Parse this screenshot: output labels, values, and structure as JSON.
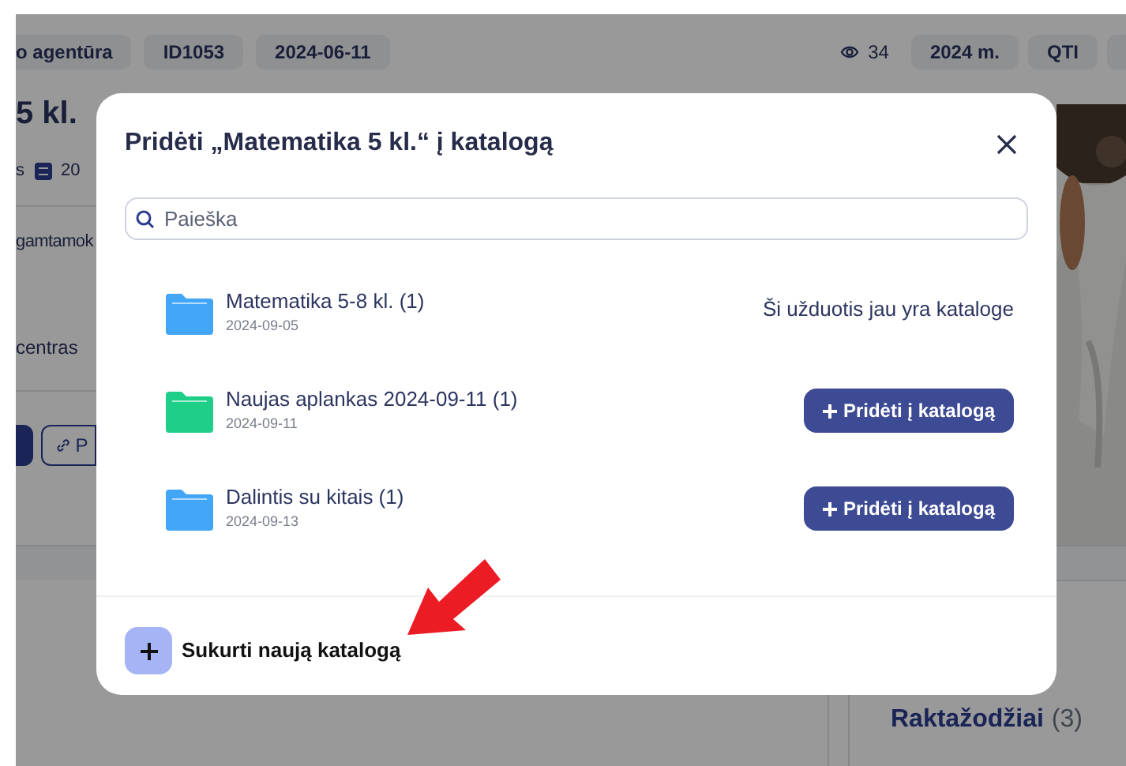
{
  "background_page": {
    "top_chips": [
      "o agentūra",
      "ID1053",
      "2024-06-11"
    ],
    "views": "34",
    "right_chips": [
      "2024 m.",
      "QTI"
    ],
    "title": "5 kl.",
    "meta": [
      "s",
      "20"
    ],
    "lines": [
      "gamtamok",
      "centras"
    ],
    "link_button": "P",
    "keywords_heading": "Raktažodžiai",
    "keywords_count": "(3)",
    "photo": {
      "kind": "picture"
    }
  },
  "dialog": {
    "title": "Pridėti „Matematika 5 kl.“ į katalogą",
    "search": {
      "placeholder": "Paieška"
    },
    "catalogs": [
      {
        "name": "Matematika 5-8 kl. (1)",
        "date": "2024-09-05",
        "color": "#42a5f5",
        "kind": "status",
        "status": "Ši užduotis jau yra kataloge"
      },
      {
        "name": "Naujas aplankas 2024-09-11 (1)",
        "date": "2024-09-11",
        "color": "#1ecf8a",
        "kind": "action",
        "button": "Pridėti į katalogą"
      },
      {
        "name": "Dalintis su kitais (1)",
        "date": "2024-09-13",
        "color": "#42a5f5",
        "kind": "action",
        "button": "Pridėti į katalogą"
      }
    ],
    "create_label": "Sukurti naują katalogą"
  }
}
